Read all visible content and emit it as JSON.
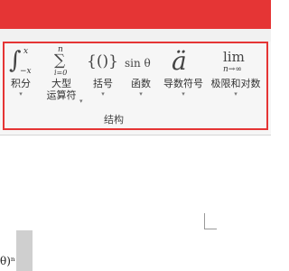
{
  "ribbon": {
    "tools": [
      {
        "label": "积分",
        "glyph": "∫",
        "sup": "x",
        "sub": "−x"
      },
      {
        "label": "大型\n运算符",
        "glyph": "∑",
        "sup": "n",
        "sub": "i=0"
      },
      {
        "label": "括号",
        "glyph": "{()}"
      },
      {
        "label": "函数",
        "glyph": "sin θ"
      },
      {
        "label": "导数符号",
        "glyph": "ä"
      },
      {
        "label": "极限和对数",
        "glyph": "lim",
        "sub": "n→∞"
      }
    ],
    "group_label": "结构"
  },
  "document": {
    "formula_fragment": "θ)ⁿ"
  },
  "colors": {
    "accent_red": "#e53535",
    "ribbon_bg": "#f6f6f6"
  },
  "icons": [
    "integral-icon",
    "large-operator-icon",
    "bracket-icon",
    "function-icon",
    "accent-icon",
    "limit-log-icon"
  ]
}
